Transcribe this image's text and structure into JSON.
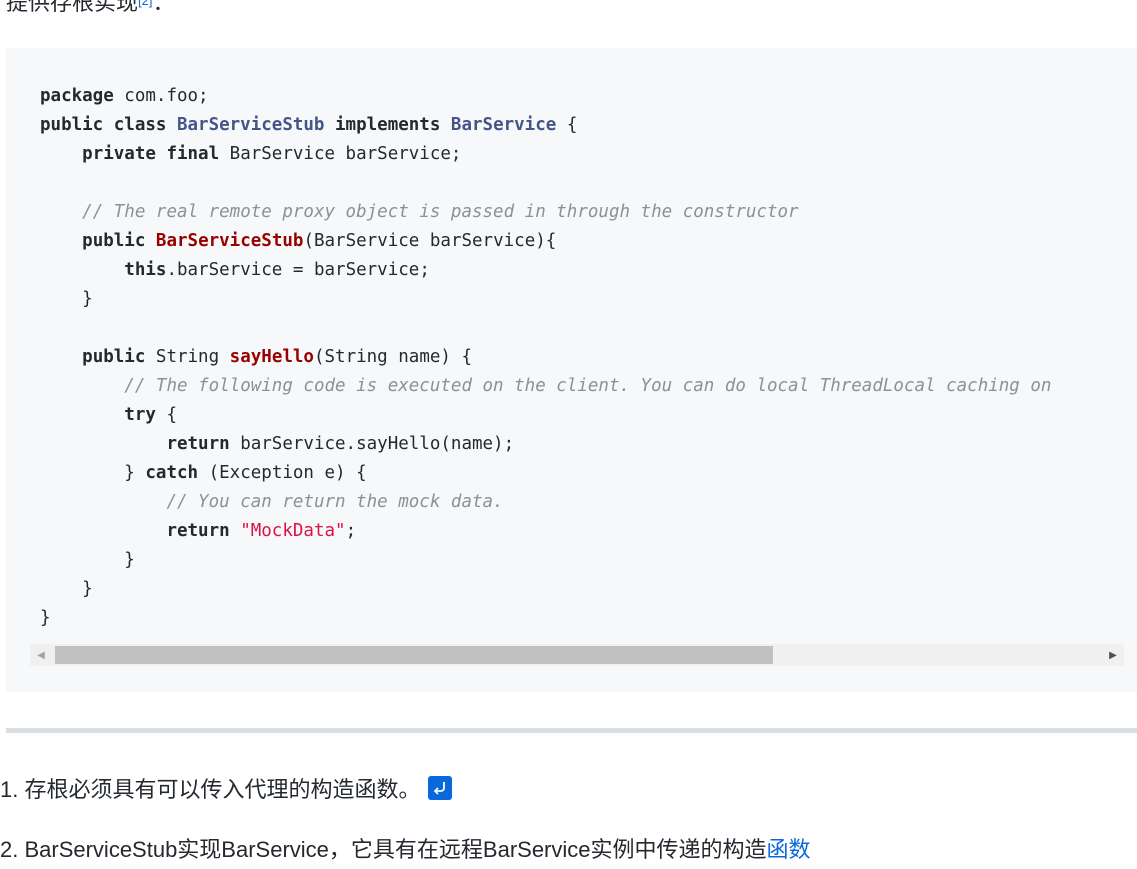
{
  "intro": {
    "text": "提供存根实现",
    "footnote": "[2]",
    "suffix": "："
  },
  "code": {
    "l1_kw": "package",
    "l1_rest": " com.foo;",
    "l2_kw1": "public class ",
    "l2_cls1": "BarServiceStub",
    "l2_kw2": " implements ",
    "l2_cls2": "BarService",
    "l2_rest": " {",
    "l3_indent": "    ",
    "l3_kw": "private final",
    "l3_rest": " BarService barService;",
    "l5_comment": "// The real remote proxy object is passed in through the constructor",
    "l6_kw": "public ",
    "l6_fn": "BarServiceStub",
    "l6_rest": "(BarService barService){",
    "l7_kw": "this",
    "l7_rest": ".barService = barService;",
    "l8": "}",
    "l10_kw": "public",
    "l10_mid": " String ",
    "l10_fn": "sayHello",
    "l10_rest": "(String name) {",
    "l11_comment": "// The following code is executed on the client. You can do local ThreadLocal caching on",
    "l12_kw": "try",
    "l12_rest": " {",
    "l13_kw": "return",
    "l13_rest": " barService.sayHello(name);",
    "l14_pre": "} ",
    "l14_kw": "catch",
    "l14_rest": " (Exception e) {",
    "l15_comment": "// You can return the mock data.",
    "l16_kw": "return",
    "l16_str": "\"MockData\"",
    "l16_rest": ";",
    "l17": "}",
    "l18": "}",
    "l19": "}"
  },
  "list": {
    "item1": "1. 存根必须具有可以传入代理的构造函数。",
    "item2_text": "2. BarServiceStub实现BarService，它具有在远程BarService实例中传递的构造",
    "item2_link": "函数"
  },
  "icons": {
    "return": "return-arrow-icon",
    "scroll_left": "scroll-left-arrow-icon",
    "scroll_right": "scroll-right-arrow-icon"
  },
  "colors": {
    "link": "#0969da",
    "code_bg": "#f6f8fa",
    "class_name": "#445588",
    "function_name": "#990000",
    "string": "#dd1144",
    "comment": "#8b9199"
  }
}
